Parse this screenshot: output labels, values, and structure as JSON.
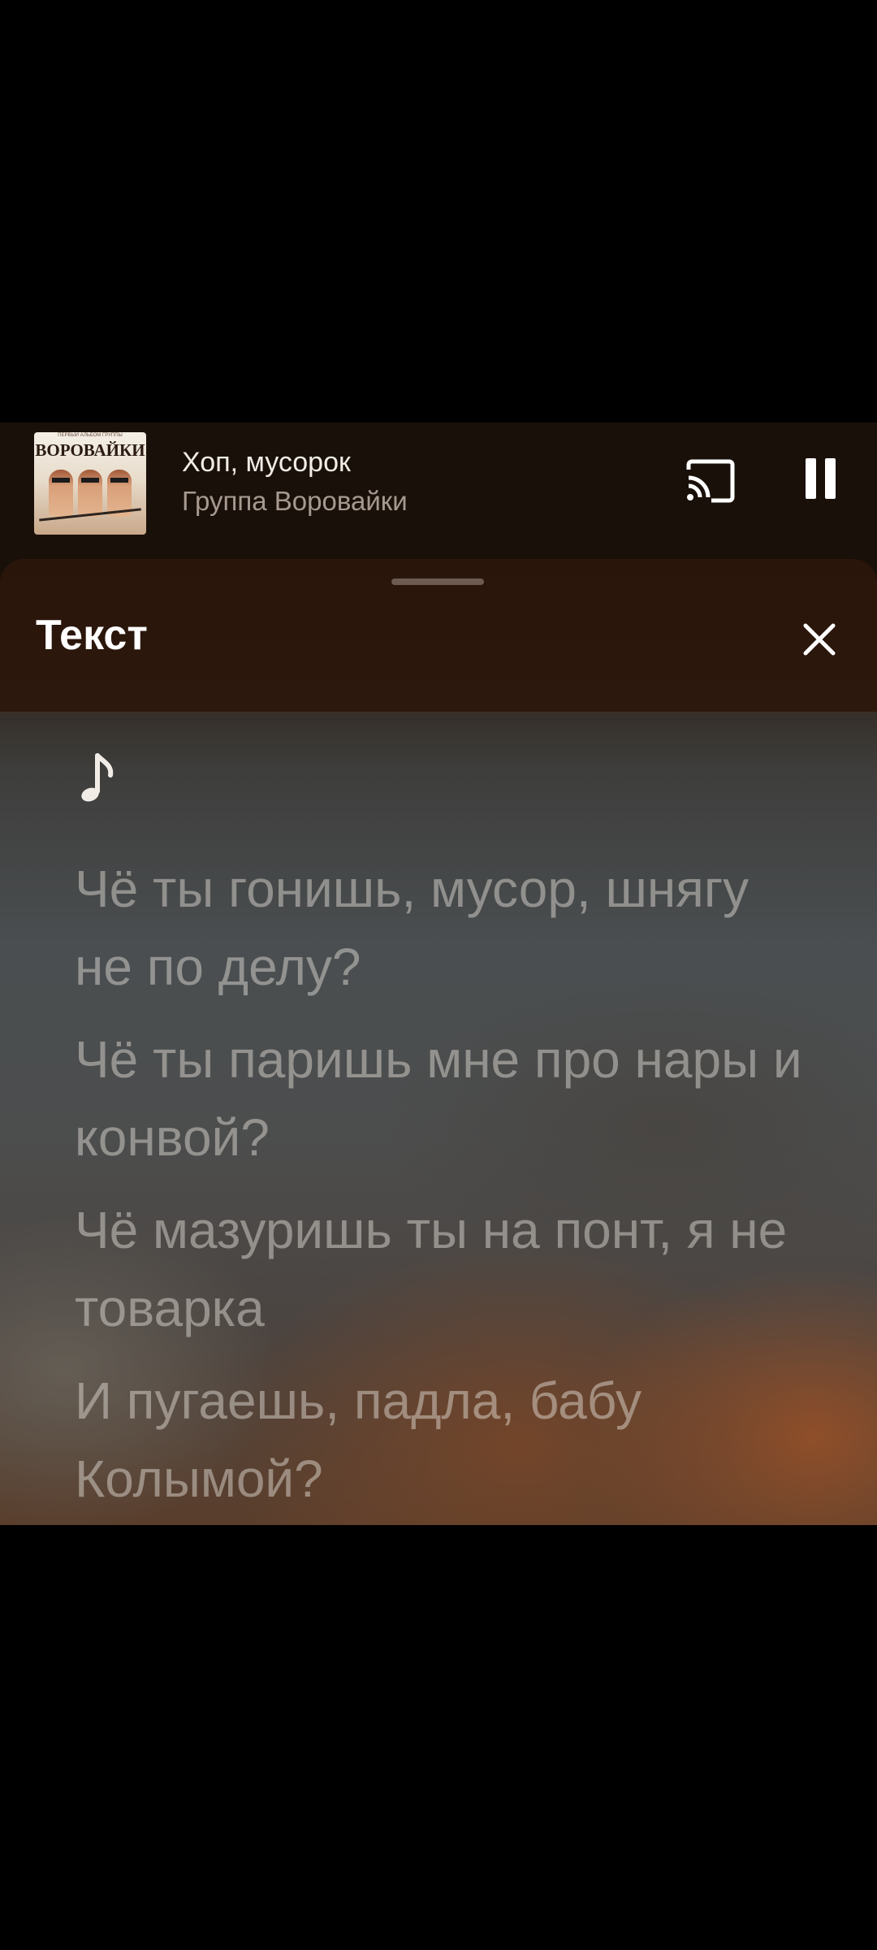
{
  "mini_player": {
    "album_art_title": "ВОРОВАЙКИ",
    "album_art_caption": "ПЕРВЫЙ АЛЬБОМ ГРУППЫ",
    "track_title": "Хоп, мусорок",
    "artist": "Группа Воровайки",
    "cast_icon": "cast-icon",
    "pause_icon": "pause-icon"
  },
  "lyrics_sheet": {
    "title": "Текст",
    "close_icon": "close-icon",
    "note_icon": "music-note-icon",
    "lines": [
      "Чё ты гонишь, мусор, шнягу не по делу?",
      "Чё ты паришь мне про нары и конвой?",
      "Чё мазуришь ты на понт, я не товарка",
      "И пугаешь, падла, бабу Колымой?"
    ]
  },
  "colors": {
    "header_bg": "#1a100a",
    "lyrics_text": "#ebe6e1",
    "accent_white": "#ffffff"
  }
}
